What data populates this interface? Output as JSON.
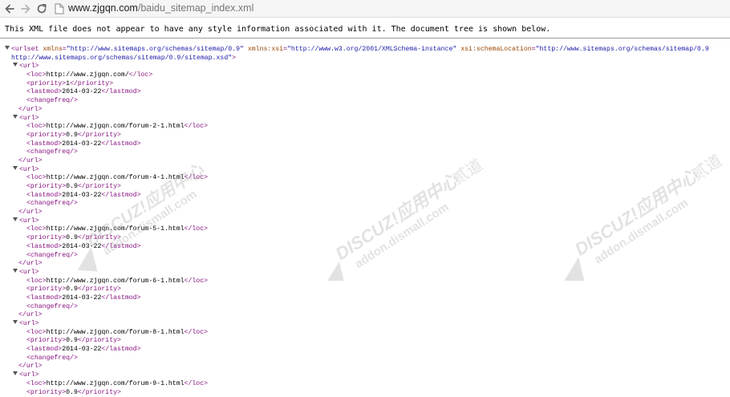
{
  "browser": {
    "url_host": "www.zjgqn.com",
    "url_path": "/baidu_sitemap_index.xml"
  },
  "viewer": {
    "info": "This XML file does not appear to have any style information associated with it. The document tree is shown below."
  },
  "xml": {
    "urlset": {
      "open": "<urlset",
      "xmlns_name": "xmlns",
      "xmlns_value": "\"http://www.sitemaps.org/schemas/sitemap/0.9\"",
      "xsi_name": "xmlns:xsi",
      "xsi_value": "\"http://www.w3.org/2001/XMLSchema-instance\"",
      "schema_name": "xsi:schemaLocation",
      "schema_value": "\"http://www.sitemaps.org/schemas/sitemap/0.9",
      "schema_value_cont": "http://www.sitemaps.org/schemas/sitemap/0.9/sitemap.xsd\"",
      "close_bracket": ">"
    },
    "tags": {
      "url_open": "<url>",
      "url_close": "</url>",
      "loc_open": "<loc>",
      "loc_close": "</loc>",
      "priority_open": "<priority>",
      "priority_close": "</priority>",
      "lastmod_open": "<lastmod>",
      "lastmod_close": "</lastmod>",
      "changefreq": "<changefreq/>"
    },
    "urls": [
      {
        "loc": "http://www.zjgqn.com/",
        "priority": "1",
        "lastmod": "2014-03-22"
      },
      {
        "loc": "http://www.zjgqn.com/forum-2-1.html",
        "priority": "0.9",
        "lastmod": "2014-03-22"
      },
      {
        "loc": "http://www.zjgqn.com/forum-4-1.html",
        "priority": "0.9",
        "lastmod": "2014-03-22"
      },
      {
        "loc": "http://www.zjgqn.com/forum-5-1.html",
        "priority": "0.9",
        "lastmod": "2014-03-22"
      },
      {
        "loc": "http://www.zjgqn.com/forum-6-1.html",
        "priority": "0.9",
        "lastmod": "2014-03-22"
      },
      {
        "loc": "http://www.zjgqn.com/forum-8-1.html",
        "priority": "0.9",
        "lastmod": "2014-03-22"
      },
      {
        "loc": "http://www.zjgqn.com/forum-9-1.html",
        "priority": "0.9",
        "lastmod": ""
      }
    ]
  },
  "watermark": {
    "brand": "DISCUZ!应用中心",
    "brand2": "贰道",
    "domain": "addon.dismall.com"
  },
  "icons": {
    "back": "back-arrow-icon",
    "forward": "forward-arrow-icon",
    "reload": "reload-icon",
    "page": "page-icon",
    "expand": "expand-triangle-icon"
  },
  "colors": {
    "tag": "#881280",
    "attr_name": "#994500",
    "attr_value": "#1a1aa6"
  }
}
